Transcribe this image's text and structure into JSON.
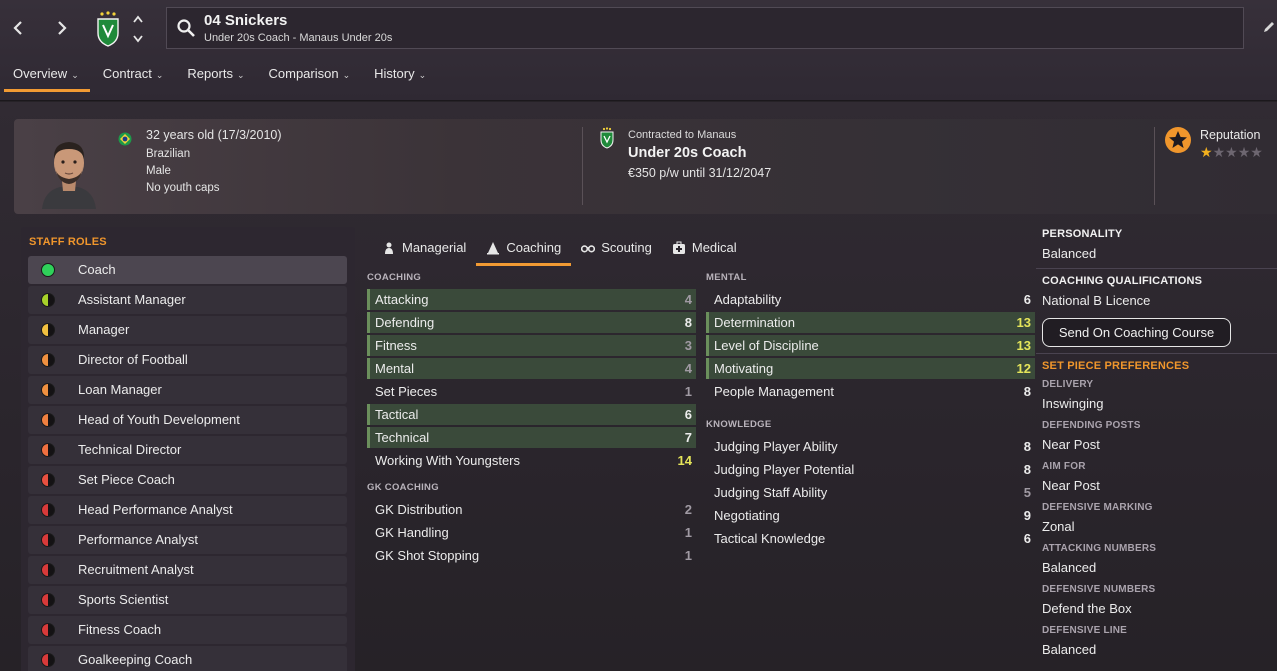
{
  "header": {
    "name": "04 Snickers",
    "subtitle": "Under 20s Coach - Manaus Under 20s"
  },
  "nav_tabs": [
    {
      "label": "Overview",
      "active": true
    },
    {
      "label": "Contract"
    },
    {
      "label": "Reports"
    },
    {
      "label": "Comparison"
    },
    {
      "label": "History"
    }
  ],
  "profile": {
    "age": "32 years old (17/3/2010)",
    "nationality": "Brazilian",
    "gender": "Male",
    "caps": "No youth caps",
    "contract_label": "Contracted to Manaus",
    "contract_role": "Under 20s Coach",
    "contract_wage": "€350 p/w until 31/12/2047",
    "reputation_label": "Reputation",
    "reputation_stars": 1,
    "reputation_max": 5
  },
  "staff_roles": {
    "title": "STAFF ROLES",
    "items": [
      {
        "label": "Coach",
        "color": "#2fd15a",
        "selected": true,
        "fit": 1.0
      },
      {
        "label": "Assistant Manager",
        "color": "#a8d22a",
        "fit": 0.5
      },
      {
        "label": "Manager",
        "color": "#f2c040",
        "fit": 0.5
      },
      {
        "label": "Director of Football",
        "color": "#f09040",
        "fit": 0.5
      },
      {
        "label": "Loan Manager",
        "color": "#f09040",
        "fit": 0.5
      },
      {
        "label": "Head of Youth Development",
        "color": "#f08040",
        "fit": 0.5
      },
      {
        "label": "Technical Director",
        "color": "#f07040",
        "fit": 0.5
      },
      {
        "label": "Set Piece Coach",
        "color": "#e85040",
        "fit": 0.5
      },
      {
        "label": "Head Performance Analyst",
        "color": "#d83a3a",
        "fit": 0.5
      },
      {
        "label": "Performance Analyst",
        "color": "#d83a3a",
        "fit": 0.5
      },
      {
        "label": "Recruitment Analyst",
        "color": "#d83a3a",
        "fit": 0.5
      },
      {
        "label": "Sports Scientist",
        "color": "#d83a3a",
        "fit": 0.5
      },
      {
        "label": "Fitness Coach",
        "color": "#d83a3a",
        "fit": 0.5
      },
      {
        "label": "Goalkeeping Coach",
        "color": "#d83a3a",
        "fit": 0.5
      }
    ]
  },
  "attr_tabs": [
    {
      "label": "Managerial",
      "icon": "managerial-icon"
    },
    {
      "label": "Coaching",
      "icon": "coaching-cone-icon",
      "active": true
    },
    {
      "label": "Scouting",
      "icon": "binoculars-icon"
    },
    {
      "label": "Medical",
      "icon": "medical-kit-icon"
    }
  ],
  "coaching": {
    "heading": "COACHING",
    "rows": [
      {
        "label": "Attacking",
        "value": "4",
        "hl": true,
        "tone": "low"
      },
      {
        "label": "Defending",
        "value": "8",
        "hl": true,
        "tone": "normal"
      },
      {
        "label": "Fitness",
        "value": "3",
        "hl": true,
        "tone": "low"
      },
      {
        "label": "Mental",
        "value": "4",
        "hl": true,
        "tone": "low"
      },
      {
        "label": "Set Pieces",
        "value": "1",
        "hl": false,
        "tone": "low"
      },
      {
        "label": "Tactical",
        "value": "6",
        "hl": true,
        "tone": "normal"
      },
      {
        "label": "Technical",
        "value": "7",
        "hl": true,
        "tone": "normal"
      },
      {
        "label": "Working With Youngsters",
        "value": "14",
        "hl": false,
        "tone": "hi"
      }
    ]
  },
  "gk_coaching": {
    "heading": "GK COACHING",
    "rows": [
      {
        "label": "GK Distribution",
        "value": "2",
        "hl": false,
        "tone": "low"
      },
      {
        "label": "GK Handling",
        "value": "1",
        "hl": false,
        "tone": "low"
      },
      {
        "label": "GK Shot Stopping",
        "value": "1",
        "hl": false,
        "tone": "low"
      }
    ]
  },
  "mental": {
    "heading": "MENTAL",
    "rows": [
      {
        "label": "Adaptability",
        "value": "6",
        "hl": false,
        "tone": "normal"
      },
      {
        "label": "Determination",
        "value": "13",
        "hl": true,
        "tone": "hi"
      },
      {
        "label": "Level of Discipline",
        "value": "13",
        "hl": true,
        "tone": "hi"
      },
      {
        "label": "Motivating",
        "value": "12",
        "hl": true,
        "tone": "hi"
      },
      {
        "label": "People Management",
        "value": "8",
        "hl": false,
        "tone": "normal"
      }
    ]
  },
  "knowledge": {
    "heading": "KNOWLEDGE",
    "rows": [
      {
        "label": "Judging Player Ability",
        "value": "8",
        "hl": false,
        "tone": "normal"
      },
      {
        "label": "Judging Player Potential",
        "value": "8",
        "hl": false,
        "tone": "normal"
      },
      {
        "label": "Judging Staff Ability",
        "value": "5",
        "hl": false,
        "tone": "low"
      },
      {
        "label": "Negotiating",
        "value": "9",
        "hl": false,
        "tone": "normal"
      },
      {
        "label": "Tactical Knowledge",
        "value": "6",
        "hl": false,
        "tone": "normal"
      }
    ]
  },
  "right": {
    "personality_h": "PERSONALITY",
    "personality": "Balanced",
    "quals_h": "COACHING QUALIFICATIONS",
    "quals": "National B Licence",
    "course_button": "Send On Coaching Course",
    "setpiece_h": "SET PIECE PREFERENCES",
    "delivery_h": "DELIVERY",
    "delivery": "Inswinging",
    "defposts_h": "DEFENDING POSTS",
    "defposts": "Near Post",
    "aim_h": "AIM FOR",
    "aim": "Near Post",
    "marking_h": "DEFENSIVE MARKING",
    "marking": "Zonal",
    "attnum_h": "ATTACKING NUMBERS",
    "attnum": "Balanced",
    "defnum_h": "DEFENSIVE NUMBERS",
    "defnum": "Defend the Box",
    "defline_h": "DEFENSIVE LINE",
    "defline": "Balanced"
  }
}
